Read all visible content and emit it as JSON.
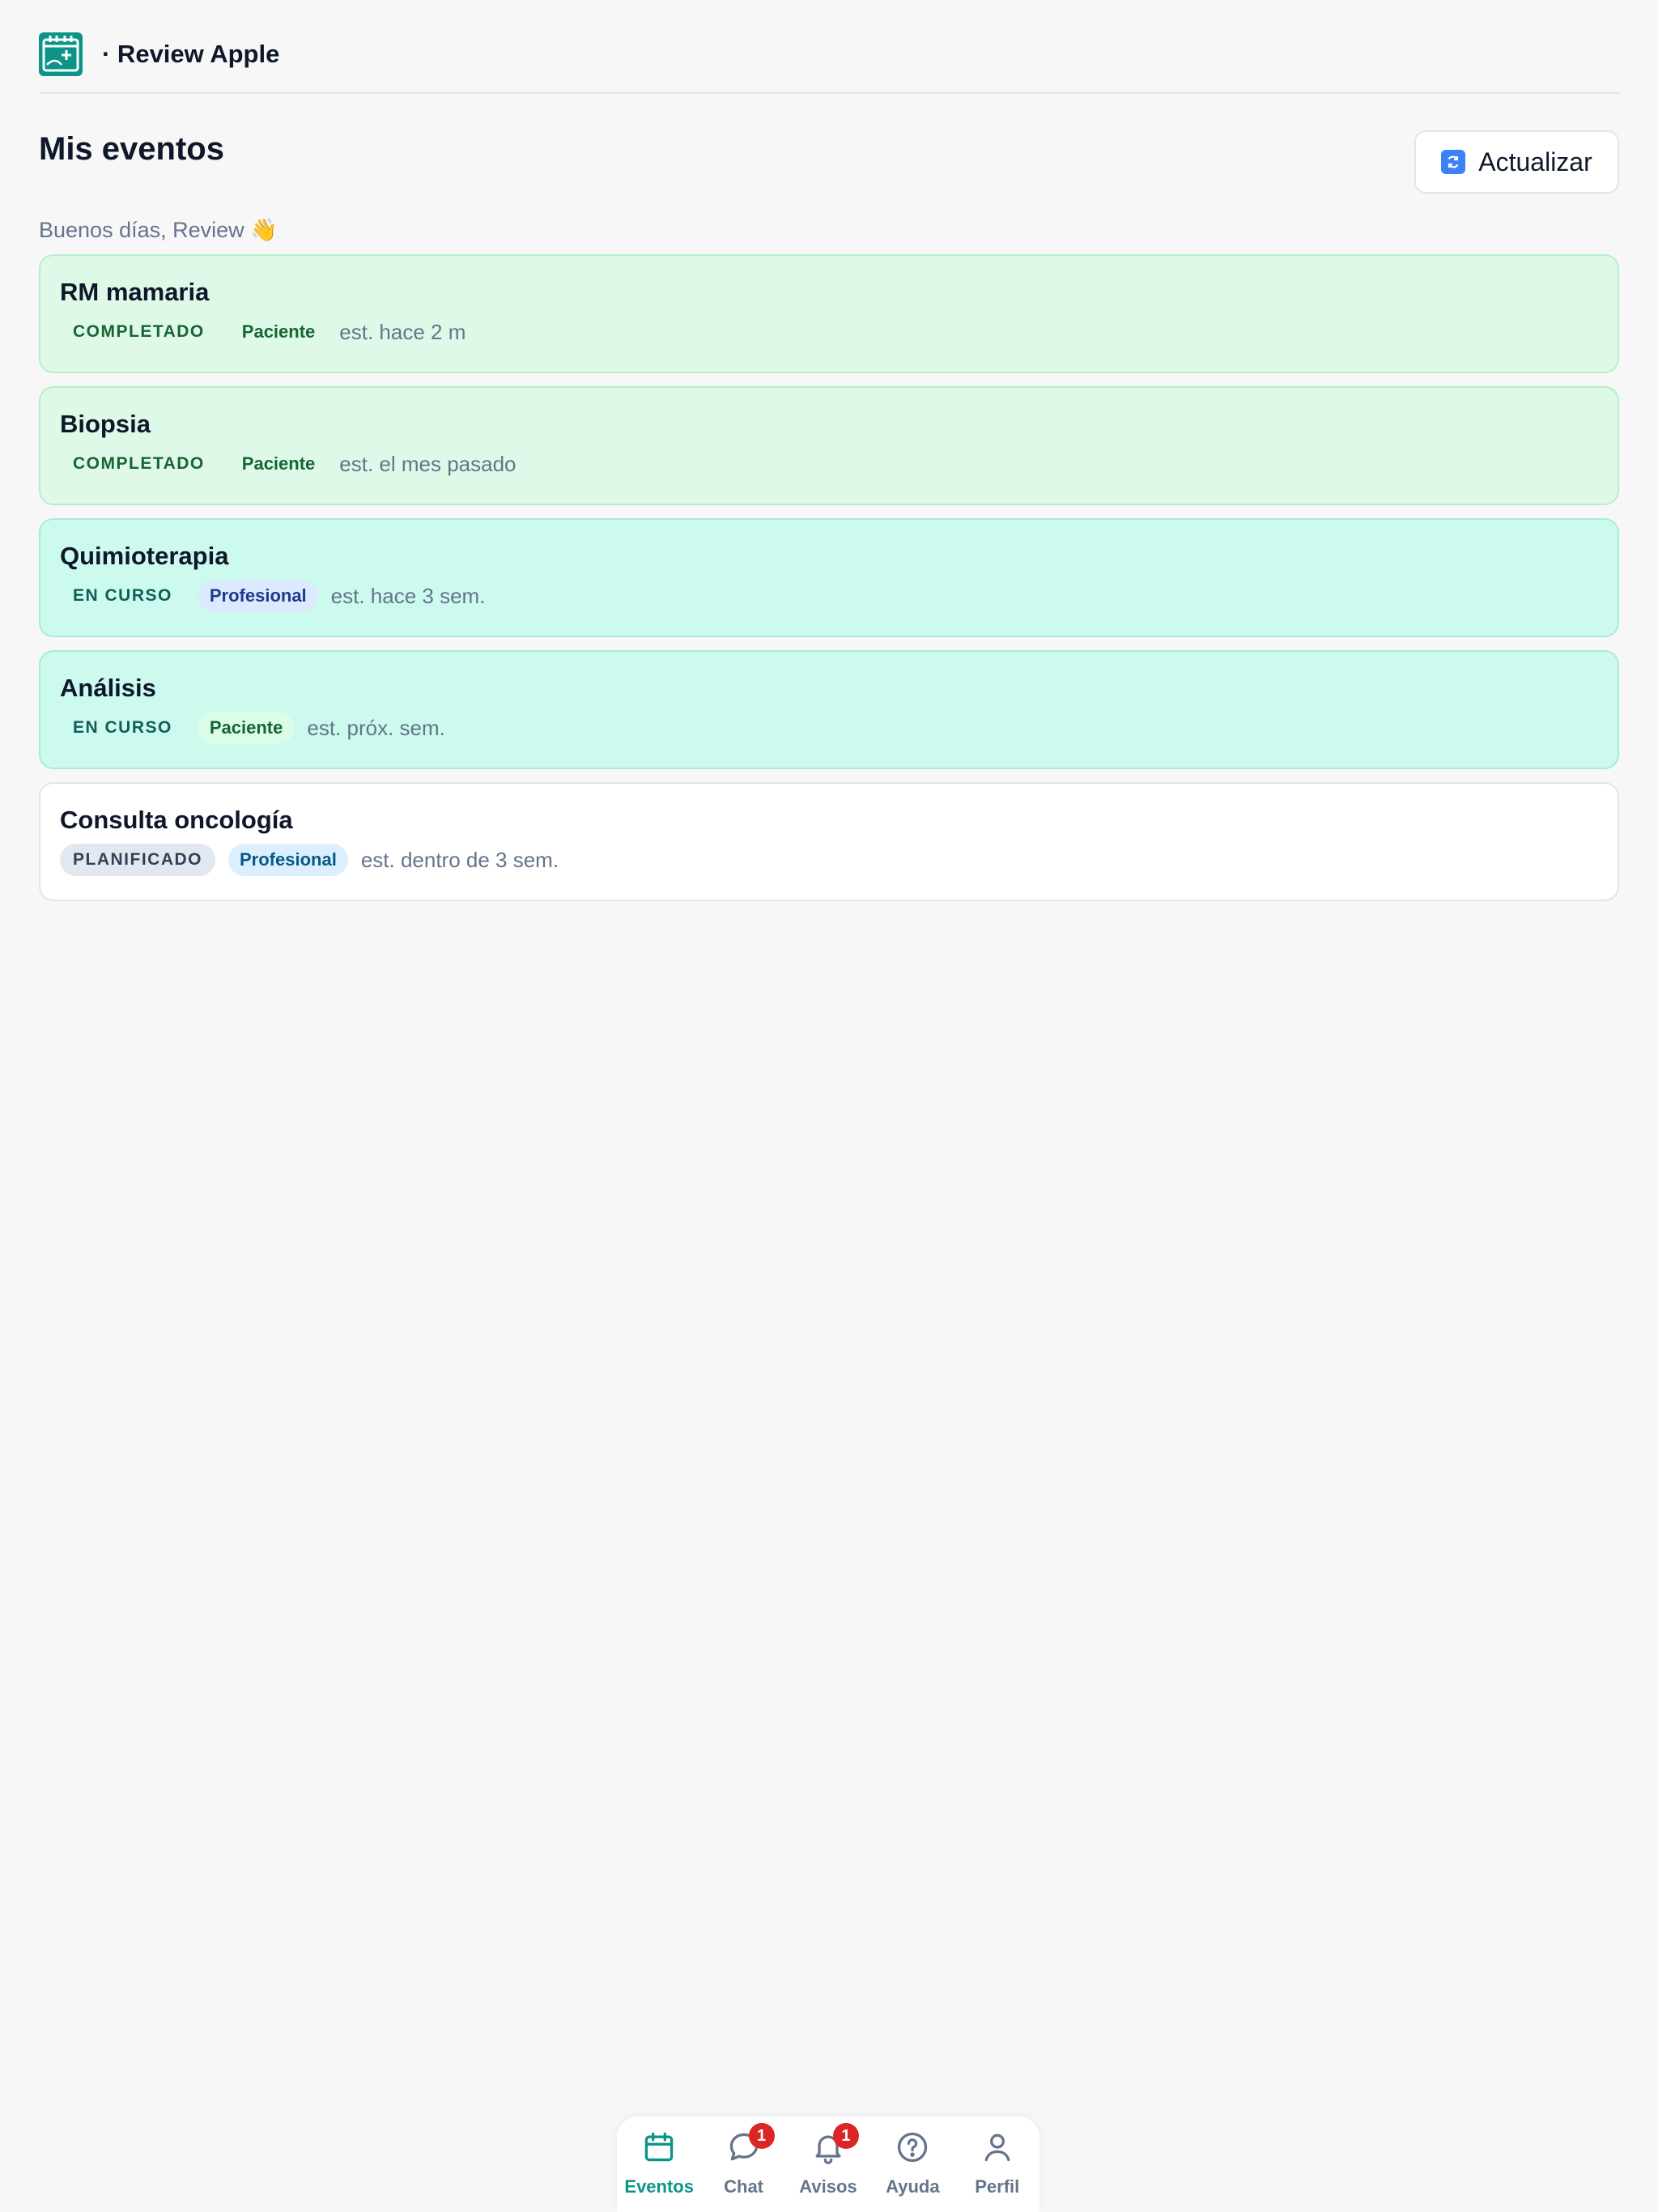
{
  "header": {
    "app_title": "· Review Apple",
    "logo_icon": "calendar-plus-icon",
    "brand_color": "#0d9488"
  },
  "main": {
    "page_title": "Mis eventos",
    "refresh_label": "Actualizar",
    "greeting": "Buenos días, Review 👋"
  },
  "events": [
    {
      "title": "RM mamaria",
      "status": "COMPLETADO",
      "role": "Paciente",
      "date": "est. hace 2 m"
    },
    {
      "title": "Biopsia",
      "status": "COMPLETADO",
      "role": "Paciente",
      "date": "est. el mes pasado"
    },
    {
      "title": "Quimioterapia",
      "status": "EN CURSO",
      "role": "Profesional",
      "date": "est. hace 3 sem."
    },
    {
      "title": "Análisis",
      "status": "EN CURSO",
      "role": "Paciente",
      "date": "est. próx. sem."
    },
    {
      "title": "Consulta oncología",
      "status": "PLANIFICADO",
      "role": "Profesional",
      "date": "est. dentro de 3 sem."
    }
  ],
  "nav": {
    "items": [
      {
        "label": "Eventos",
        "icon": "calendar-icon",
        "active": true
      },
      {
        "label": "Chat",
        "icon": "chat-bubble-icon",
        "badge": "1"
      },
      {
        "label": "Avisos",
        "icon": "bell-icon",
        "badge": "1"
      },
      {
        "label": "Ayuda",
        "icon": "help-circle-icon"
      },
      {
        "label": "Perfil",
        "icon": "user-icon"
      }
    ]
  },
  "colors": {
    "completed_bg": "#dff9e8",
    "inprogress_bg": "#cdfaee",
    "badge": "#dc2626"
  }
}
